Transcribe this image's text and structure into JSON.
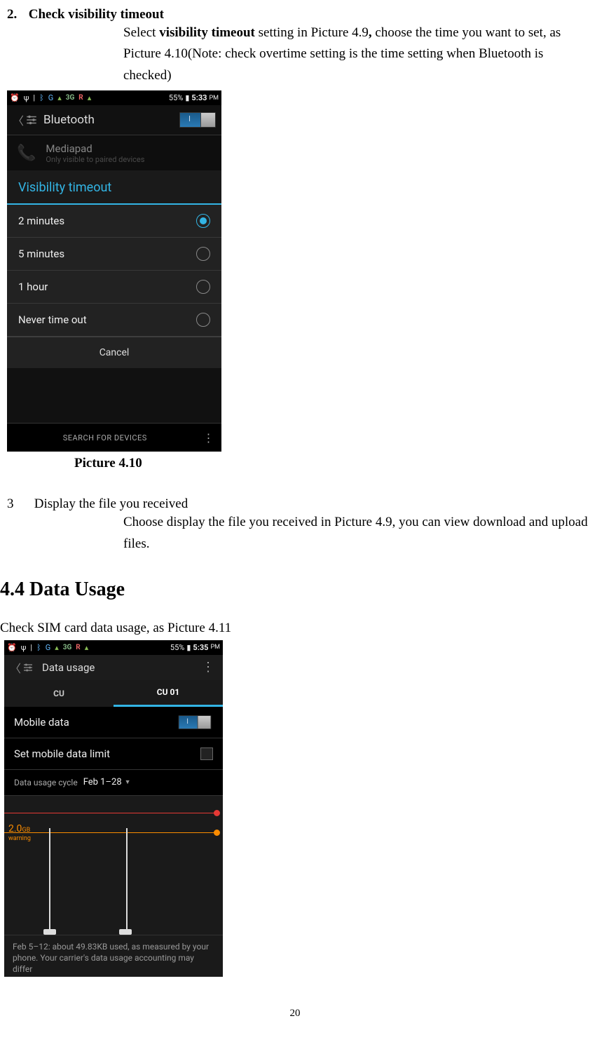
{
  "section2": {
    "num": "2.",
    "title": "Check visibility timeout",
    "para_a": "Select ",
    "para_bold": "visibility timeout",
    "para_b": " setting in Picture 4.9",
    "para_comma": ",",
    "para_c": " choose the time you want to set, as Picture 4.10(Note: check overtime setting is the time setting when Bluetooth is checked)"
  },
  "shot1": {
    "status": {
      "battery": "55%",
      "time": "5:33",
      "ampm": "PM",
      "net": "3G",
      "g": "G"
    },
    "header_title": "Bluetooth",
    "toggle_label": "I",
    "device": {
      "name": "Mediapad",
      "sub": "Only visible to paired devices"
    },
    "dialog_title": "Visibility timeout",
    "opts": [
      "2 minutes",
      "5 minutes",
      "1 hour",
      "Never time out"
    ],
    "cancel": "Cancel",
    "search": "SEARCH FOR DEVICES"
  },
  "caption1": "Picture 4.10",
  "section3": {
    "num": "3",
    "title": "Display the file you received",
    "para": "Choose display the file you received in Picture 4.9, you can view download and upload files."
  },
  "h2": "4.4 Data Usage",
  "body1": "Check SIM card data usage, as Picture 4.11",
  "shot2": {
    "status": {
      "battery": "55%",
      "time": "5:35",
      "ampm": "PM",
      "net": "3G",
      "g": "G"
    },
    "header_title": "Data usage",
    "tabs": [
      "CU",
      "CU 01"
    ],
    "mobile_data": "Mobile data",
    "set_limit": "Set mobile data limit",
    "cycle_label": "Data usage cycle",
    "cycle_value": "Feb 1–28",
    "warn_value": "2.0",
    "warn_unit": "GB",
    "warn_word": "warning",
    "summary": "Feb 5–12: about 49.83KB used, as measured by your phone. Your carrier's data usage accounting may differ"
  },
  "pagenum": "20"
}
